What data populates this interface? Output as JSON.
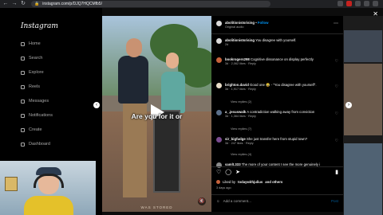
{
  "browser": {
    "url": "instagram.com/p/DJQ7HQCMfb5/"
  },
  "sidebar": {
    "logo": "Instagram",
    "items": [
      {
        "label": "Home"
      },
      {
        "label": "Search"
      },
      {
        "label": "Explore"
      },
      {
        "label": "Reels"
      },
      {
        "label": "Messages"
      },
      {
        "label": "Notifications"
      },
      {
        "label": "Create"
      },
      {
        "label": "Dashboard"
      }
    ]
  },
  "video": {
    "caption": "Are you for it or",
    "watermark": "WAS STORED"
  },
  "post": {
    "author": "abolitionistsrising",
    "follow_label": "Follow",
    "audio": "Original audio",
    "caption_user": "abolitionistsrising",
    "caption_text": "You disagree with yourself.",
    "caption_meta": "2d",
    "comments": [
      {
        "user": "bookrogers298",
        "text": "Cognitive dissonance on display perfectly",
        "meta": "3d · 2,062 likes · Reply"
      },
      {
        "user": "brighton.david",
        "text": "Good one 😂 - \"You disagree with yourself\".",
        "meta": "3d · 1,917 likes · Reply",
        "replies": "View replies (2)"
      },
      {
        "user": "a_.jesuswalk",
        "text": "A contradiction walking away from conviction",
        "meta": "3d · 1,364 likes · Reply",
        "replies": "View replies (7)"
      },
      {
        "user": "sir_bigfudge",
        "text": "She just transfer here from stupid town?",
        "meta": "3d · 247 likes · Reply",
        "replies": "View replies (4)"
      },
      {
        "user": "samlt.333",
        "text": "The more of your content I see the more genuinely i",
        "meta": ""
      }
    ],
    "liked_by_prefix": "Liked by",
    "liked_by_user": "todaywithjulius",
    "liked_by_suffix": "and others",
    "date": "3 days ago",
    "add_comment_placeholder": "Add a comment...",
    "post_label": "Post"
  },
  "colors": {
    "accent": "#0095f6",
    "background": "#000000",
    "muted": "#a8a8a8"
  }
}
